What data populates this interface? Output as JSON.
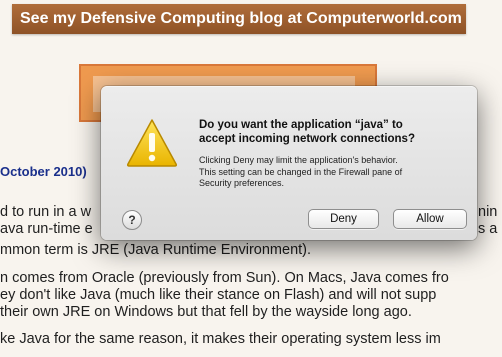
{
  "webpage": {
    "banner": {
      "prefix": "See my ",
      "blog_name": "Defensive Computing blog",
      "middle": " at ",
      "site": "Computerworld.com"
    },
    "date_fragment": "October 2010)",
    "paragraph1": [
      "d to run in a w",
      "ava run-time e",
      "mmon term is JRE (Java Runtime Environment)."
    ],
    "paragraph1_right": [
      "nin",
      "s a"
    ],
    "paragraph2": [
      "n comes from Oracle (previously from Sun). On Macs, Java comes fro",
      "ey don't like Java (much like their stance on Flash) and will not supp",
      "their own JRE on Windows but that fell by the wayside long ago."
    ],
    "paragraph3": [
      "ke Java for the same reason, it makes their operating system less im"
    ]
  },
  "dialog": {
    "title_line1": "Do you want the application “java” to",
    "title_line2": "accept incoming network connections?",
    "message_line1": "Clicking Deny may limit the application's behavior.",
    "message_line2": "This setting can be changed in the Firewall pane of",
    "message_line3": "Security preferences.",
    "help_label": "?",
    "deny_label": "Deny",
    "allow_label": "Allow",
    "icon": "warning-icon",
    "icon_color": "#f2c200"
  }
}
